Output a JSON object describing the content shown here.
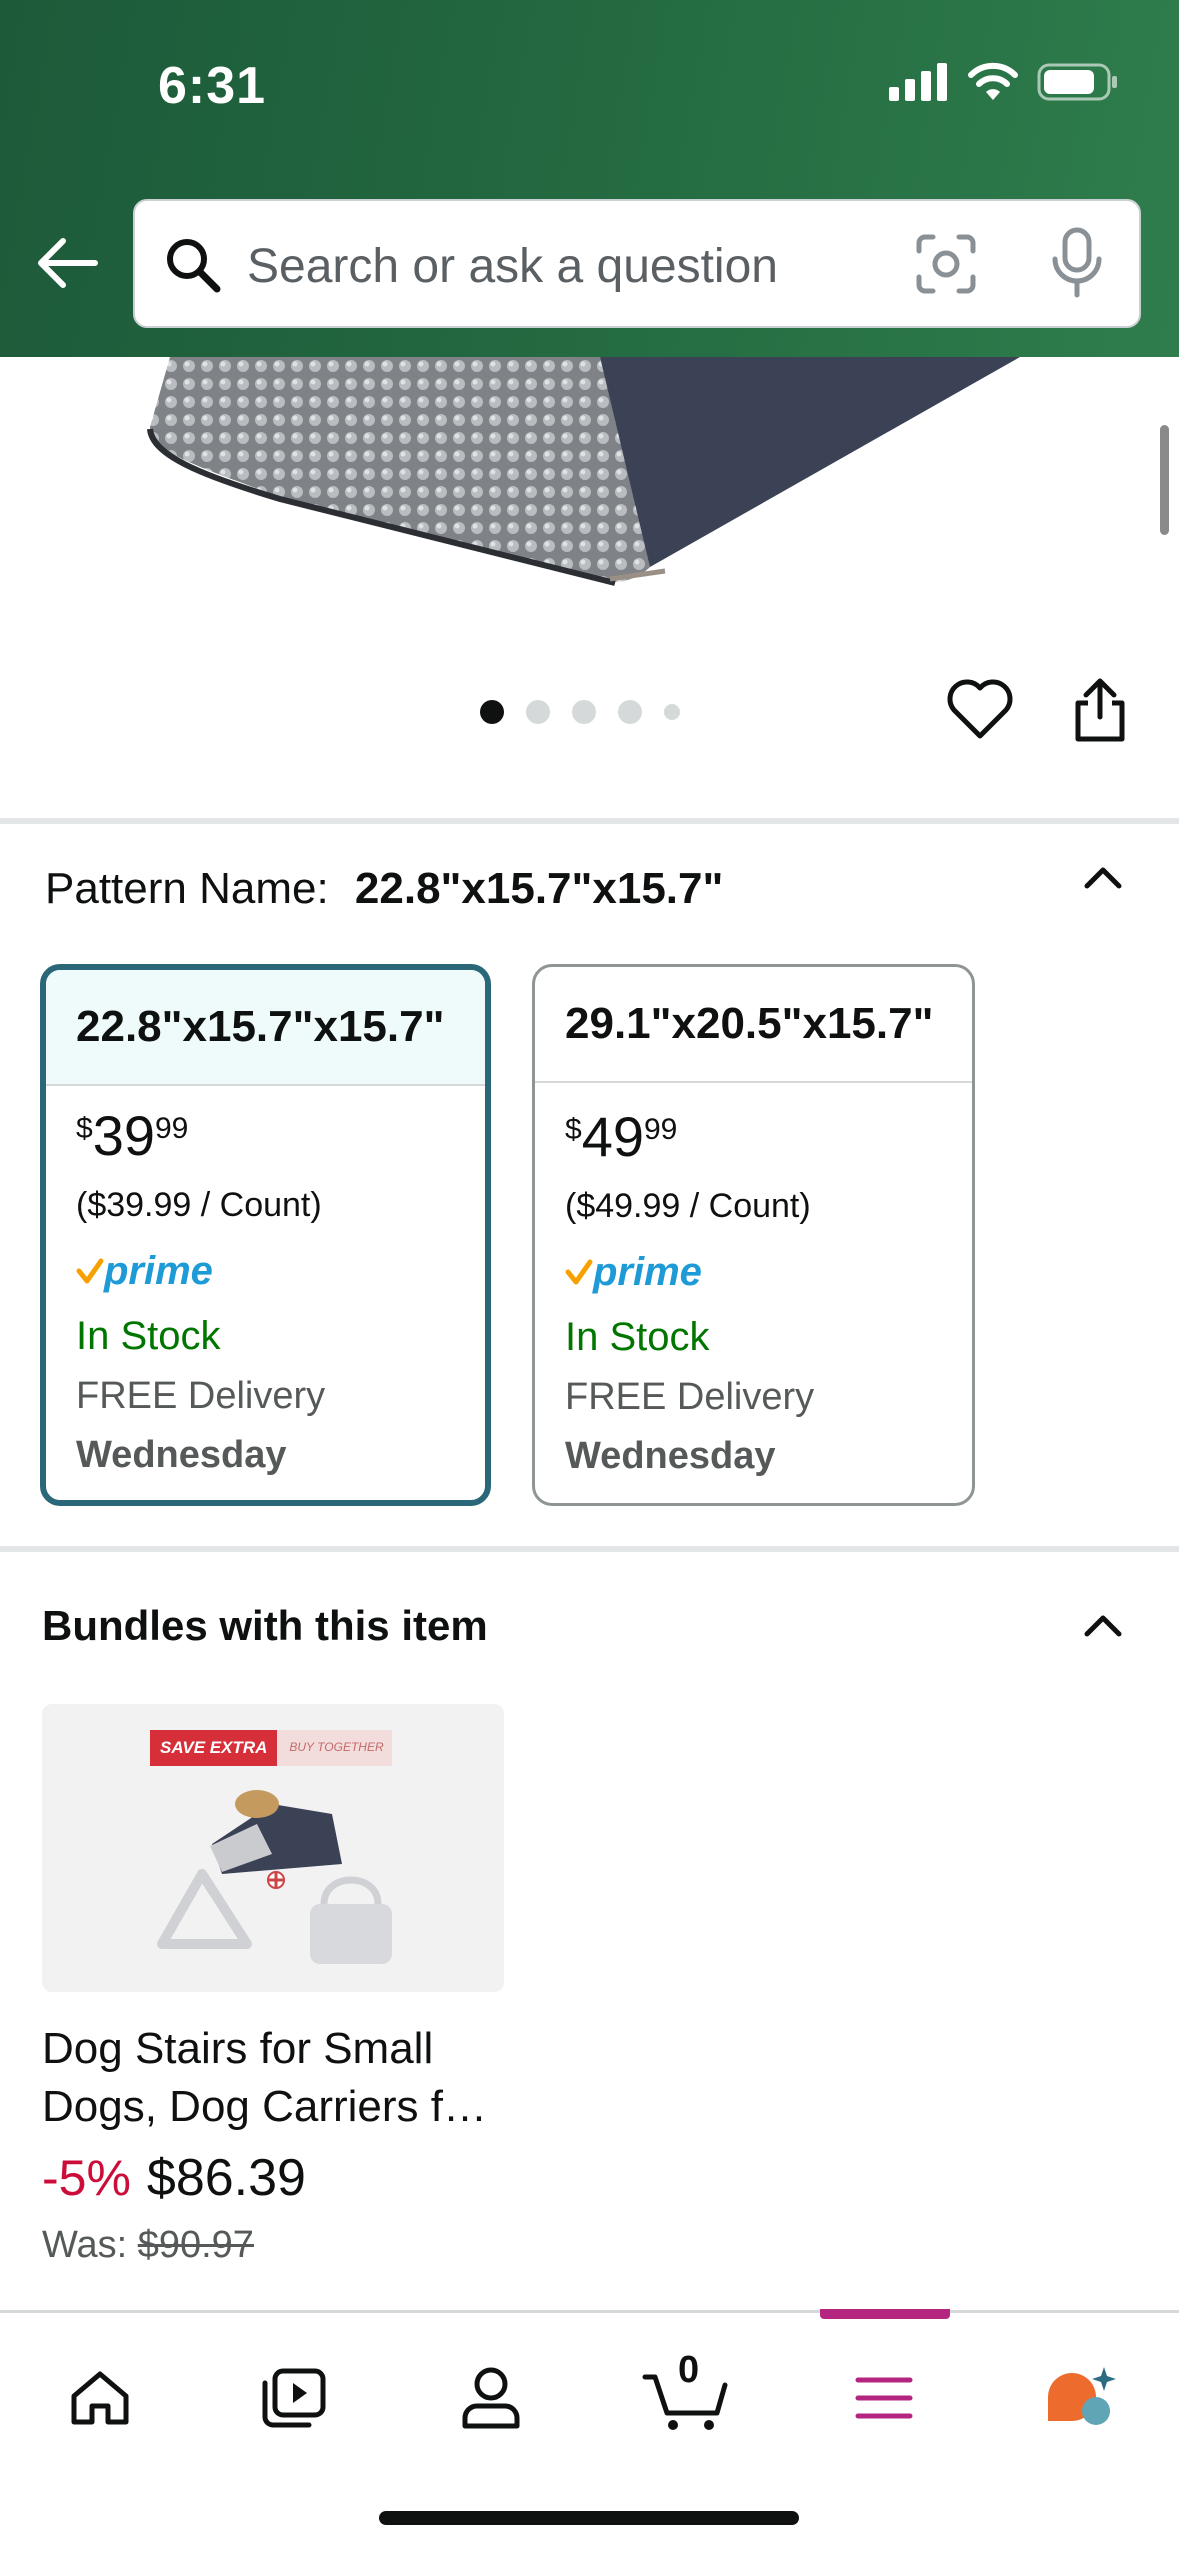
{
  "status_bar": {
    "time": "6:31"
  },
  "search": {
    "placeholder": "Search or ask a question"
  },
  "gallery": {
    "image_count": 5,
    "active_index": 0
  },
  "pattern": {
    "label": "Pattern Name:",
    "selected_value": "22.8\"x15.7\"x15.7\"",
    "options": [
      {
        "name": "22.8\"x15.7\"x15.7\"",
        "currency": "$",
        "price_whole": "39",
        "price_fraction": "99",
        "unit_price": "($39.99 / Count)",
        "prime": "prime",
        "stock": "In Stock",
        "delivery": "FREE Delivery",
        "day": "Wednesday",
        "selected": true
      },
      {
        "name": "29.1\"x20.5\"x15.7\"",
        "currency": "$",
        "price_whole": "49",
        "price_fraction": "99",
        "unit_price": "($49.99 / Count)",
        "prime": "prime",
        "stock": "In Stock",
        "delivery": "FREE Delivery",
        "day": "Wednesday",
        "selected": false
      }
    ]
  },
  "bundles": {
    "title": "Bundles with this item",
    "item": {
      "banner_main": "SAVE EXTRA",
      "banner_sub": "BUY TOGETHER",
      "name": "Dog Stairs for Small Dogs, Dog Carriers f…",
      "discount": "-5%",
      "price": "$86.39",
      "was_label": "Was:",
      "was_price": "$90.97"
    }
  },
  "bottom_nav": {
    "items": [
      "home-icon",
      "video-icon",
      "account-icon",
      "cart-icon",
      "menu-icon",
      "rufus-icon"
    ],
    "cart_count": "0",
    "active": "menu-icon"
  },
  "colors": {
    "header_green": "#226840",
    "selected_border": "#2a6778",
    "in_stock": "#007600",
    "discount": "#cc0c39",
    "prime_blue": "#1e9ad6",
    "nav_active": "#b3257f"
  }
}
